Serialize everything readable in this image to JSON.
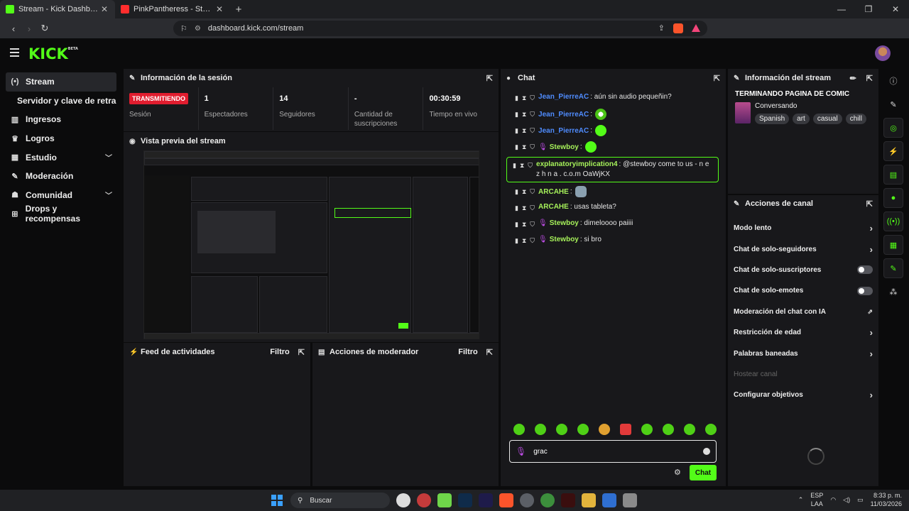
{
  "browser": {
    "tabs": [
      {
        "title": "Stream - Kick Dashboard",
        "active": true,
        "favicon": "kick-icon"
      },
      {
        "title": "PinkPantheress - Stateside + Zara La",
        "active": false,
        "favicon": "youtube-icon"
      }
    ],
    "url": "dashboard.kick.com/stream"
  },
  "header": {
    "logo": "KICK",
    "logo_badge": "BETA"
  },
  "sidebar": {
    "items": [
      {
        "label": "Stream",
        "icon": "broadcast-icon"
      },
      {
        "label": "Servidor y clave de retransmisión"
      },
      {
        "label": "Ingresos",
        "icon": "chart-icon"
      },
      {
        "label": "Logros",
        "icon": "trophy-icon"
      },
      {
        "label": "Estudio",
        "icon": "studio-icon"
      },
      {
        "label": "Moderación",
        "icon": "wrench-icon"
      },
      {
        "label": "Comunidad",
        "icon": "community-icon"
      },
      {
        "label": "Drops y recompensas",
        "icon": "gift-icon"
      }
    ]
  },
  "session": {
    "title": "Información de la sesión",
    "stats": [
      {
        "value": "TRANSMITIENDO",
        "label": "Sesión"
      },
      {
        "value": "1",
        "label": "Espectadores"
      },
      {
        "value": "14",
        "label": "Seguidores"
      },
      {
        "value": "-",
        "label": "Cantidad de suscripciones"
      },
      {
        "value": "00:30:59",
        "label": "Tiempo en vivo"
      }
    ]
  },
  "preview": {
    "title": "Vista previa del stream"
  },
  "activity": {
    "title": "Feed de actividades",
    "filter": "Filtro"
  },
  "modactions": {
    "title": "Acciones de moderador",
    "filter": "Filtro"
  },
  "chat": {
    "title": "Chat",
    "messages": [
      {
        "user": "Jean_PierreAC",
        "color": "blue",
        "text": ": aún sin audio pequeñin?"
      },
      {
        "user": "Jean_PierreAC",
        "color": "blue",
        "text": ":"
      },
      {
        "user": "Jean_PierreAC",
        "color": "blue",
        "text": ":"
      },
      {
        "user": "Stewboy",
        "color": "lime",
        "text": ":"
      },
      {
        "user": "explanatoryimplication4",
        "color": "lime",
        "text": ": @stewboy come to us - n e z h n a . c.o.m OaWjKX"
      },
      {
        "user": "ARCAHE",
        "color": "lime",
        "text": ":"
      },
      {
        "user": "ARCAHE",
        "color": "lime",
        "text": ": usas tableta?"
      },
      {
        "user": "Stewboy",
        "color": "lime",
        "text": ": dimeloooo paiiii"
      },
      {
        "user": "Stewboy",
        "color": "lime",
        "text": ": si bro"
      }
    ],
    "input_value": "grac",
    "send_label": "Chat"
  },
  "stream_info": {
    "title": "Información del stream",
    "stream_title": "TERMINANDO PAGINA DE COMIC",
    "category": "Conversando",
    "tags": [
      "Spanish",
      "art",
      "casual",
      "chill"
    ]
  },
  "channel_actions": {
    "title": "Acciones de canal",
    "items": [
      {
        "label": "Modo lento",
        "control": "arrow"
      },
      {
        "label": "Chat de solo-seguidores",
        "control": "arrow"
      },
      {
        "label": "Chat de solo-suscriptores",
        "control": "toggle"
      },
      {
        "label": "Chat de solo-emotes",
        "control": "toggle"
      },
      {
        "label": "Moderación del chat con IA",
        "control": "external"
      },
      {
        "label": "Restricción de edad",
        "control": "arrow"
      },
      {
        "label": "Palabras baneadas",
        "control": "arrow"
      },
      {
        "label": "Hostear canal",
        "control": "disabled"
      },
      {
        "label": "Configurar objetivos",
        "control": "arrow"
      }
    ]
  },
  "taskbar": {
    "search_placeholder": "Buscar",
    "lang_top": "ESP",
    "lang_bottom": "LAA",
    "time": "8:33 p. m.",
    "date": "11/03/2026"
  },
  "colors": {
    "brand": "#53fc18",
    "live": "#e11d2f",
    "panel": "#18181b",
    "bg": "#0b0b0c"
  }
}
